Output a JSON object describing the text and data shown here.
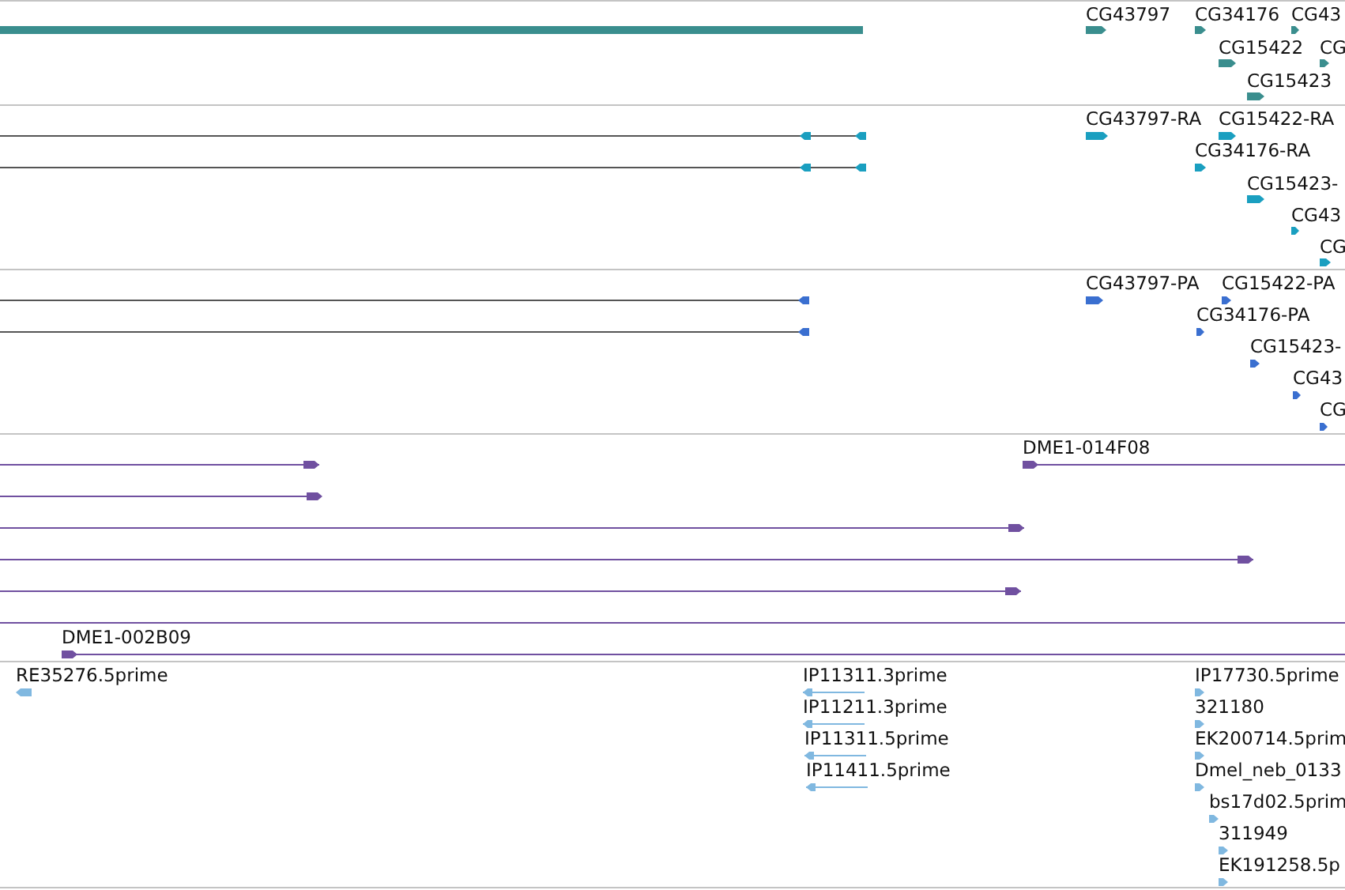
{
  "tracks": [
    {
      "kind": "gene",
      "color": "#3a8e8e",
      "features": [
        {
          "kind": "block"
        },
        {
          "kind": "glyph",
          "label": "CG43797",
          "reverse": false
        },
        {
          "kind": "glyph",
          "label": "CG34176",
          "reverse": false
        },
        {
          "kind": "glyph",
          "label": "CG43",
          "reverse": false
        },
        {
          "kind": "glyph",
          "label": "CG15422",
          "reverse": false
        },
        {
          "kind": "glyph",
          "label": "CG",
          "reverse": false
        },
        {
          "kind": "glyph",
          "label": "CG15423",
          "reverse": false
        }
      ]
    },
    {
      "kind": "transcript",
      "color": "#1a9fc0",
      "features": [
        {
          "kind": "span",
          "reverse": true
        },
        {
          "kind": "span",
          "reverse": true
        },
        {
          "kind": "glyph",
          "label": "CG43797-RA",
          "reverse": false
        },
        {
          "kind": "glyph",
          "label": "CG15422-RA",
          "reverse": false
        },
        {
          "kind": "glyph",
          "label": "CG34176-RA",
          "reverse": false
        },
        {
          "kind": "glyph",
          "label": "CG15423-",
          "reverse": false
        },
        {
          "kind": "glyph",
          "label": "CG43",
          "reverse": false
        },
        {
          "kind": "glyph",
          "label": "CG",
          "reverse": false
        }
      ]
    },
    {
      "kind": "protein",
      "color": "#3a6fd0",
      "features": [
        {
          "kind": "span",
          "reverse": true
        },
        {
          "kind": "span",
          "reverse": true
        },
        {
          "kind": "glyph",
          "label": "CG43797-PA",
          "reverse": false
        },
        {
          "kind": "glyph",
          "label": "CG15422-PA",
          "reverse": false
        },
        {
          "kind": "glyph",
          "label": "CG34176-PA",
          "reverse": false
        },
        {
          "kind": "glyph",
          "label": "CG15423-",
          "reverse": false
        },
        {
          "kind": "glyph",
          "label": "CG43",
          "reverse": false
        },
        {
          "kind": "glyph",
          "label": "CG",
          "reverse": false
        }
      ]
    },
    {
      "kind": "clone",
      "color": "#7050a0",
      "features": [
        {
          "kind": "span",
          "label": "DME1-014F08",
          "reverse": false
        },
        {
          "kind": "span",
          "reverse": false
        },
        {
          "kind": "span",
          "reverse": false
        },
        {
          "kind": "span",
          "reverse": false
        },
        {
          "kind": "span",
          "reverse": false
        },
        {
          "kind": "span",
          "reverse": false
        },
        {
          "kind": "span"
        },
        {
          "kind": "span",
          "label": "DME1-002B09",
          "reverse": false
        }
      ]
    },
    {
      "kind": "est",
      "color": "#80b8e0",
      "features": [
        {
          "kind": "glyph",
          "label": "RE35276.5prime",
          "reverse": true
        },
        {
          "kind": "span",
          "label": "IP11311.3prime",
          "reverse": true
        },
        {
          "kind": "span",
          "label": "IP11211.3prime",
          "reverse": true
        },
        {
          "kind": "span",
          "label": "IP11311.5prime",
          "reverse": true
        },
        {
          "kind": "span",
          "label": "IP11411.5prime",
          "reverse": true
        },
        {
          "kind": "glyph",
          "label": "IP17730.5prime",
          "reverse": false
        },
        {
          "kind": "glyph",
          "label": "321180",
          "reverse": false
        },
        {
          "kind": "glyph",
          "label": "EK200714.5prim",
          "reverse": false
        },
        {
          "kind": "glyph",
          "label": "Dmel_neb_0133",
          "reverse": false
        },
        {
          "kind": "glyph",
          "label": "bs17d02.5prim",
          "reverse": false
        },
        {
          "kind": "glyph",
          "label": "311949",
          "reverse": false
        },
        {
          "kind": "glyph",
          "label": "EK191258.5p",
          "reverse": false
        }
      ]
    }
  ]
}
